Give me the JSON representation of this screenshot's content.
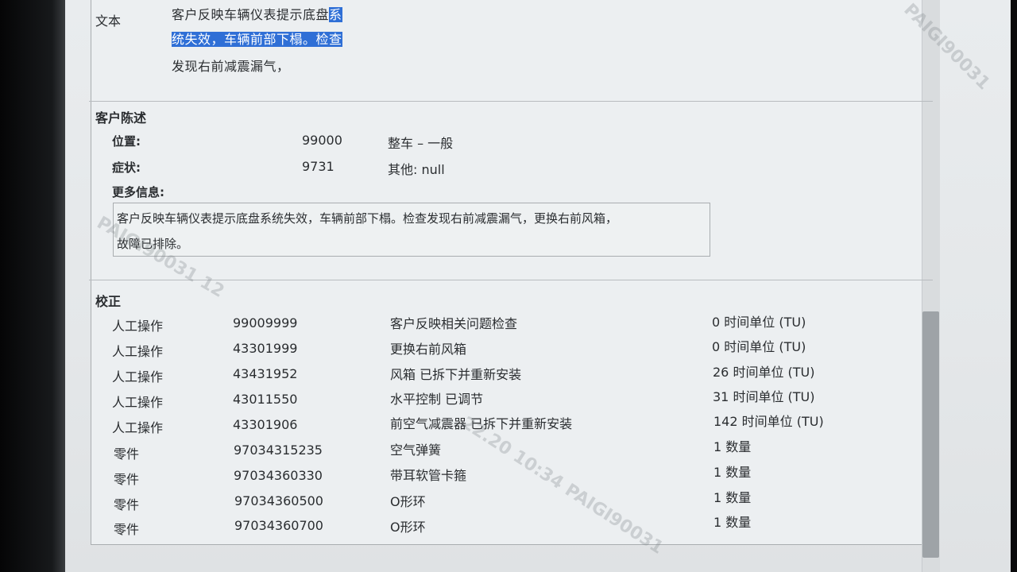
{
  "text_section": {
    "label": "文本",
    "lines": [
      {
        "plain": "客户反映车辆仪表提示底盘",
        "highlighted": "系"
      },
      {
        "plain": "",
        "highlighted": "统失效，车辆前部下榻。检查"
      },
      {
        "plain": "发现右前减震漏气，",
        "highlighted": ""
      }
    ]
  },
  "customer_statement": {
    "title": "客户陈述",
    "position": {
      "label": "位置:",
      "code": "99000",
      "value": "整车 – 一般"
    },
    "symptom": {
      "label": "症状:",
      "code": "9731",
      "value": "其他: null"
    },
    "more_info": {
      "label": "更多信息:",
      "lines": [
        "客户反映车辆仪表提示底盘系统失效，车辆前部下榻。检查发现右前减震漏气，更换右前风箱，",
        "故障已排除。"
      ]
    }
  },
  "correction": {
    "title": "校正",
    "rows": [
      {
        "type": "人工操作",
        "code": "99009999",
        "desc": "客户反映相关问题检查",
        "qty": "0 时间单位 (TU)"
      },
      {
        "type": "人工操作",
        "code": "43301999",
        "desc": "更换右前风箱",
        "qty": "0 时间单位 (TU)"
      },
      {
        "type": "人工操作",
        "code": "43431952",
        "desc": "风箱 已拆下并重新安装",
        "qty": "26 时间单位 (TU)"
      },
      {
        "type": "人工操作",
        "code": "43011550",
        "desc": "水平控制 已调节",
        "qty": "31 时间单位 (TU)"
      },
      {
        "type": "人工操作",
        "code": "43301906",
        "desc": "前空气减震器 已拆下并重新安装",
        "qty": "142 时间单位 (TU)"
      },
      {
        "type": "零件",
        "code": "97034315235",
        "desc": "空气弹簧",
        "qty": "1 数量"
      },
      {
        "type": "零件",
        "code": "97034360330",
        "desc": "带耳软管卡箍",
        "qty": "1 数量"
      },
      {
        "type": "零件",
        "code": "97034360500",
        "desc": "O形环",
        "qty": "1 数量"
      },
      {
        "type": "零件",
        "code": "97034360700",
        "desc": "O形环",
        "qty": "1 数量"
      }
    ]
  },
  "watermarks": [
    "PAIGI90031",
    "PAIGI90031 12",
    "22.20 10:34  PAIGI90031"
  ]
}
